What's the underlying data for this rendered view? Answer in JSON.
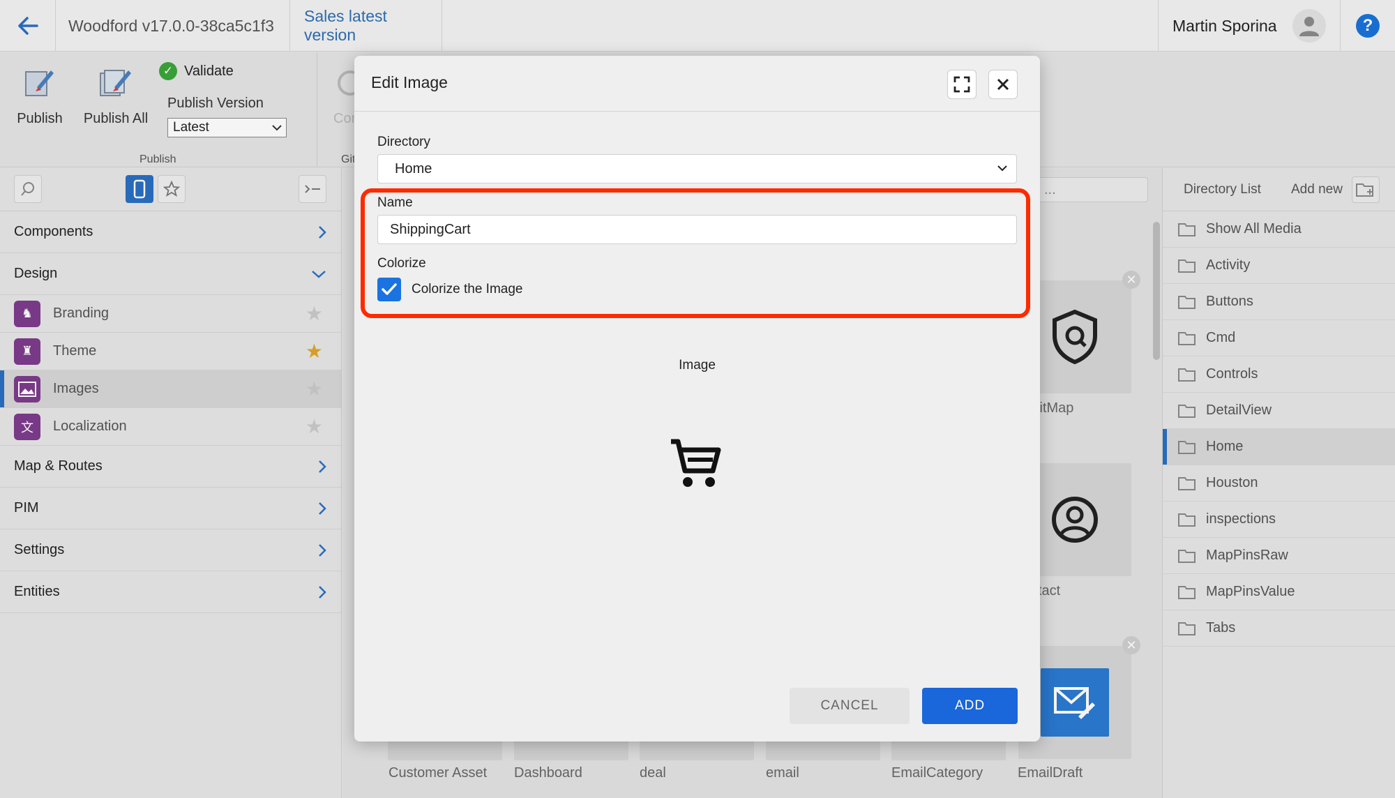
{
  "header": {
    "app_title": "Woodford v17.0.0-38ca5c1f3",
    "version_tab": "Sales latest version",
    "user_name": "Martin Sporina",
    "help_label": "?"
  },
  "ribbon": {
    "publish_label": "Publish",
    "publish_all_label": "Publish All",
    "validate_label": "Validate",
    "publish_version_label": "Publish Version",
    "publish_version_value": "Latest",
    "group_publish": "Publish",
    "group_git": "Git",
    "partial_button": "Cor"
  },
  "sidebar": {
    "sections": [
      {
        "label": "Components",
        "expanded": false
      },
      {
        "label": "Design",
        "expanded": true
      },
      {
        "label": "Map & Routes",
        "expanded": false
      },
      {
        "label": "PIM",
        "expanded": false
      },
      {
        "label": "Settings",
        "expanded": false
      },
      {
        "label": "Entities",
        "expanded": false
      }
    ],
    "design_items": [
      {
        "label": "Branding",
        "favorite": false
      },
      {
        "label": "Theme",
        "favorite": true
      },
      {
        "label": "Images",
        "favorite": false,
        "selected": true
      },
      {
        "label": "Localization",
        "favorite": false
      }
    ]
  },
  "background": {
    "search_placeholder": "...",
    "tile_labels": [
      "litMap",
      "tact"
    ],
    "bottom_labels": [
      "Customer Asset",
      "Dashboard",
      "deal",
      "email",
      "EmailCategory",
      "EmailDraft"
    ]
  },
  "right_panel": {
    "directory_list_label": "Directory List",
    "add_new_label": "Add new",
    "directories": [
      "Show All Media",
      "Activity",
      "Buttons",
      "Cmd",
      "Controls",
      "DetailView",
      "Home",
      "Houston",
      "inspections",
      "MapPinsRaw",
      "MapPinsValue",
      "Tabs"
    ],
    "selected_directory": "Home"
  },
  "modal": {
    "title": "Edit Image",
    "directory_label": "Directory",
    "directory_value": "Home",
    "name_label": "Name",
    "name_value": "ShippingCart",
    "colorize_label": "Colorize",
    "colorize_checkbox_label": "Colorize the Image",
    "colorize_checked": true,
    "image_label": "Image",
    "cancel_label": "CANCEL",
    "add_label": "ADD"
  },
  "colors": {
    "accent": "#1a66db",
    "highlight": "#ff2a00",
    "favorite_star": "#e0a526",
    "app_icon": "#7d3c8c"
  },
  "icons": {
    "back": "arrow-left-icon",
    "avatar": "user-icon",
    "help": "help-icon",
    "expand": "expand-icon",
    "close": "close-icon",
    "image": "shopping-cart-icon"
  }
}
